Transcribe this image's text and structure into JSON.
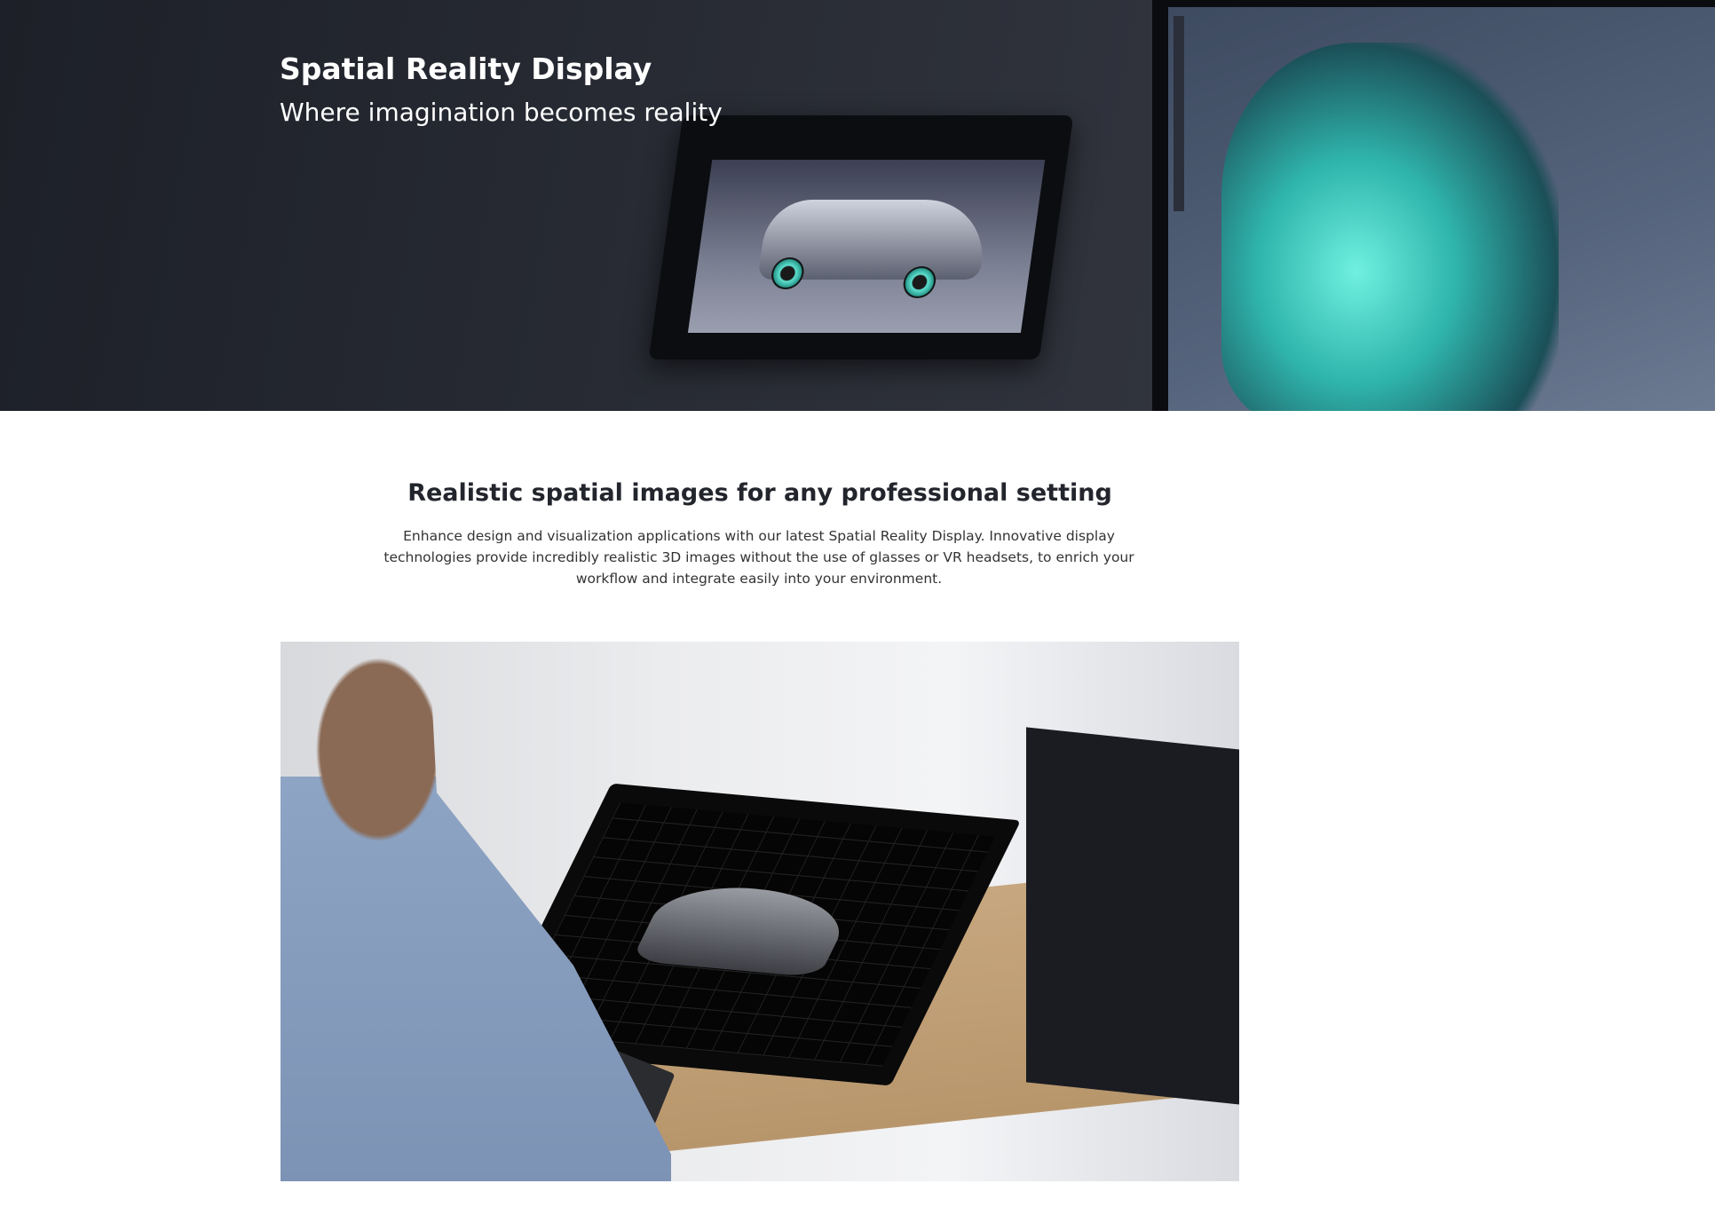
{
  "hero": {
    "title": "Spatial Reality Display",
    "subtitle": "Where imagination becomes reality"
  },
  "section": {
    "title": "Realistic spatial images for any professional setting",
    "body": "Enhance design and visualization applications with our latest Spatial Reality Display. Innovative display technologies provide incredibly realistic 3D images without the use of glasses or VR headsets, to enrich your workflow and integrate easily into your environment."
  },
  "colors": {
    "hero_bg": "#23262e",
    "heading": "#23252d",
    "accent_teal": "#5fe0cf"
  }
}
